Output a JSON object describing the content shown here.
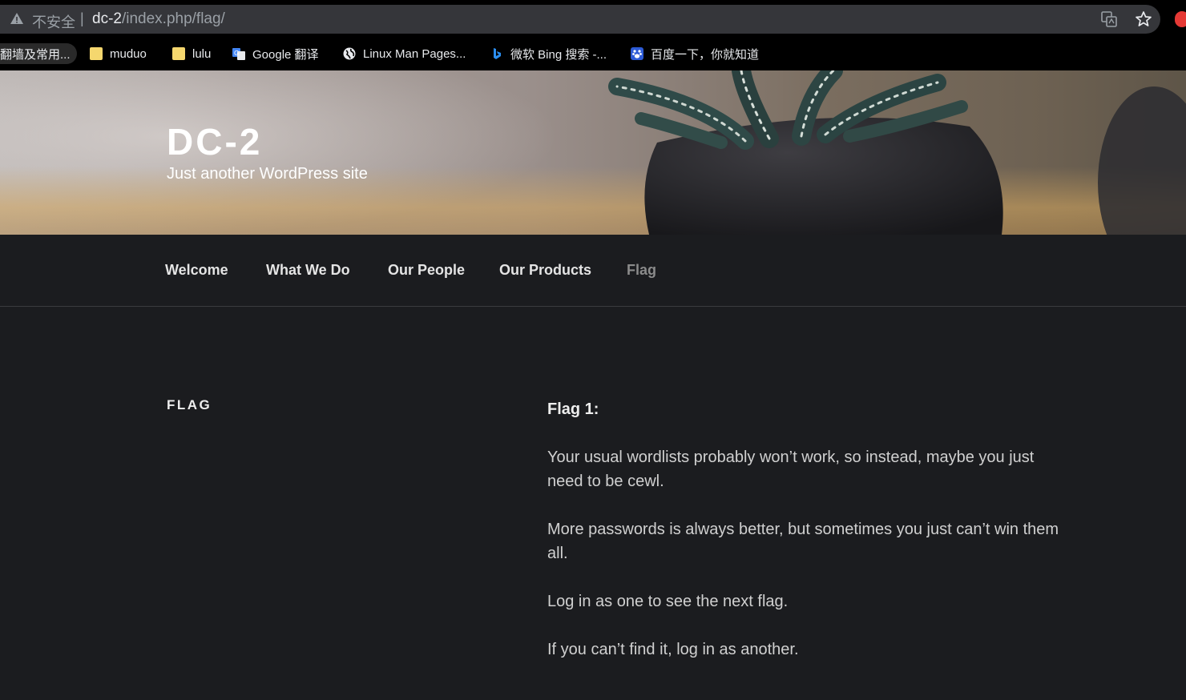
{
  "browser": {
    "insecure_label": "不安全",
    "separator": "|",
    "url_host": "dc-2",
    "url_path": "/index.php/flag/"
  },
  "bookmarks": [
    {
      "label": "翻墙及常用...",
      "icon": "folder-icon"
    },
    {
      "label": "muduo",
      "icon": "folder-icon"
    },
    {
      "label": "lulu",
      "icon": "folder-icon"
    },
    {
      "label": "Google 翻译",
      "icon": "google-translate-icon"
    },
    {
      "label": "Linux Man Pages...",
      "icon": "globe-icon"
    },
    {
      "label": "微软 Bing 搜索 -...",
      "icon": "bing-icon"
    },
    {
      "label": "百度一下，你就知道",
      "icon": "baidu-icon"
    }
  ],
  "site": {
    "title": "DC-2",
    "description": "Just another WordPress site"
  },
  "nav": {
    "items": [
      {
        "label": "Welcome"
      },
      {
        "label": "What We Do"
      },
      {
        "label": "Our People"
      },
      {
        "label": "Our Products"
      },
      {
        "label": "Flag",
        "current": true
      }
    ]
  },
  "page": {
    "heading": "FLAG",
    "entry_title": "Flag 1:",
    "paragraphs": [
      "Your usual wordlists probably won’t work, so instead, maybe you just need to be cewl.",
      "More passwords is always better, but sometimes you just can’t win them all.",
      "Log in as one to see the next flag.",
      "If you can’t find it, log in as another."
    ]
  },
  "colors": {
    "page_bg": "#1b1c1f",
    "nav_current": "#8b8b8b",
    "text": "#d0d0d0"
  }
}
